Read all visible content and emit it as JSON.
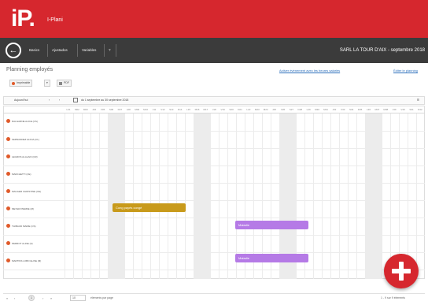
{
  "header": {
    "logo": "iP.",
    "app_name": "I-Plani",
    "company": "SARL LA TOUR D'AIX - septembre 2018"
  },
  "nav": {
    "back_icon": "arrow-left-icon",
    "items": [
      {
        "label": "Basics"
      },
      {
        "label": "Ajustados"
      },
      {
        "label": "Variables"
      },
      {
        "label": "?"
      }
    ]
  },
  "page": {
    "title": "Planning employés",
    "links": [
      {
        "label": "Activer événement avec les heures salariés"
      },
      {
        "label": "Éditer le planning"
      }
    ]
  },
  "toolbar": {
    "buttons": [
      {
        "label": "Imprimable"
      },
      {
        "label": "▾"
      },
      {
        "label": "PDF"
      }
    ]
  },
  "filter": {
    "view_label": "Aujourd'hui",
    "prev": "‹",
    "next": "›",
    "range": "du 1 septembre au 30 septembre 2018",
    "menu_icon": "menu-icon"
  },
  "days": [
    "L01",
    "M02",
    "M03",
    "J04",
    "V05",
    "S06",
    "D07",
    "L08",
    "M09",
    "M10",
    "J11",
    "V12",
    "S13",
    "D14",
    "L15",
    "M16",
    "M17",
    "J18",
    "V19",
    "S20",
    "D21",
    "L22",
    "M23",
    "M24",
    "J25",
    "V26",
    "S27",
    "D28",
    "L29",
    "M30",
    "M31",
    "J32",
    "V33",
    "S34",
    "D35",
    "L36",
    "M37",
    "M38",
    "J39",
    "V40",
    "S41",
    "D42",
    "L43",
    "M44"
  ],
  "employees": [
    {
      "name": "DALGARNE ALICE (CS)"
    },
    {
      "name": "FERNANDEZ ALICIA (CL)"
    },
    {
      "name": "LEGROS ALALAIN (CR)"
    },
    {
      "name": "MARCHETTI (CE)"
    },
    {
      "name": "MAUGER CHRISTINE (CE)"
    },
    {
      "name": "MEYER PIERRE (M)"
    },
    {
      "name": "THIBAUD MARIE (CS)"
    },
    {
      "name": "PERROT ALINE (S)"
    },
    {
      "name": "MARTINS LOBO ELISE (M)"
    }
  ],
  "events": [
    {
      "label": "Cong payés congé",
      "color": "#c89a1b"
    },
    {
      "label": "Maladie",
      "color": "#b57ae6"
    },
    {
      "label": "Maladie",
      "color": "#b57ae6"
    }
  ],
  "fab": {
    "icon": "plus-icon"
  },
  "pager": {
    "first": "«",
    "prev": "‹",
    "page": "1",
    "next": "›",
    "last": "»",
    "per_page": "10",
    "per_page_label": "éléments par page",
    "summary": "1 - 9 sur 9 éléments"
  },
  "colors": {
    "brand_red": "#d6272e",
    "nav_dark": "#3b3b3b",
    "weekend_gray": "#ececec"
  }
}
